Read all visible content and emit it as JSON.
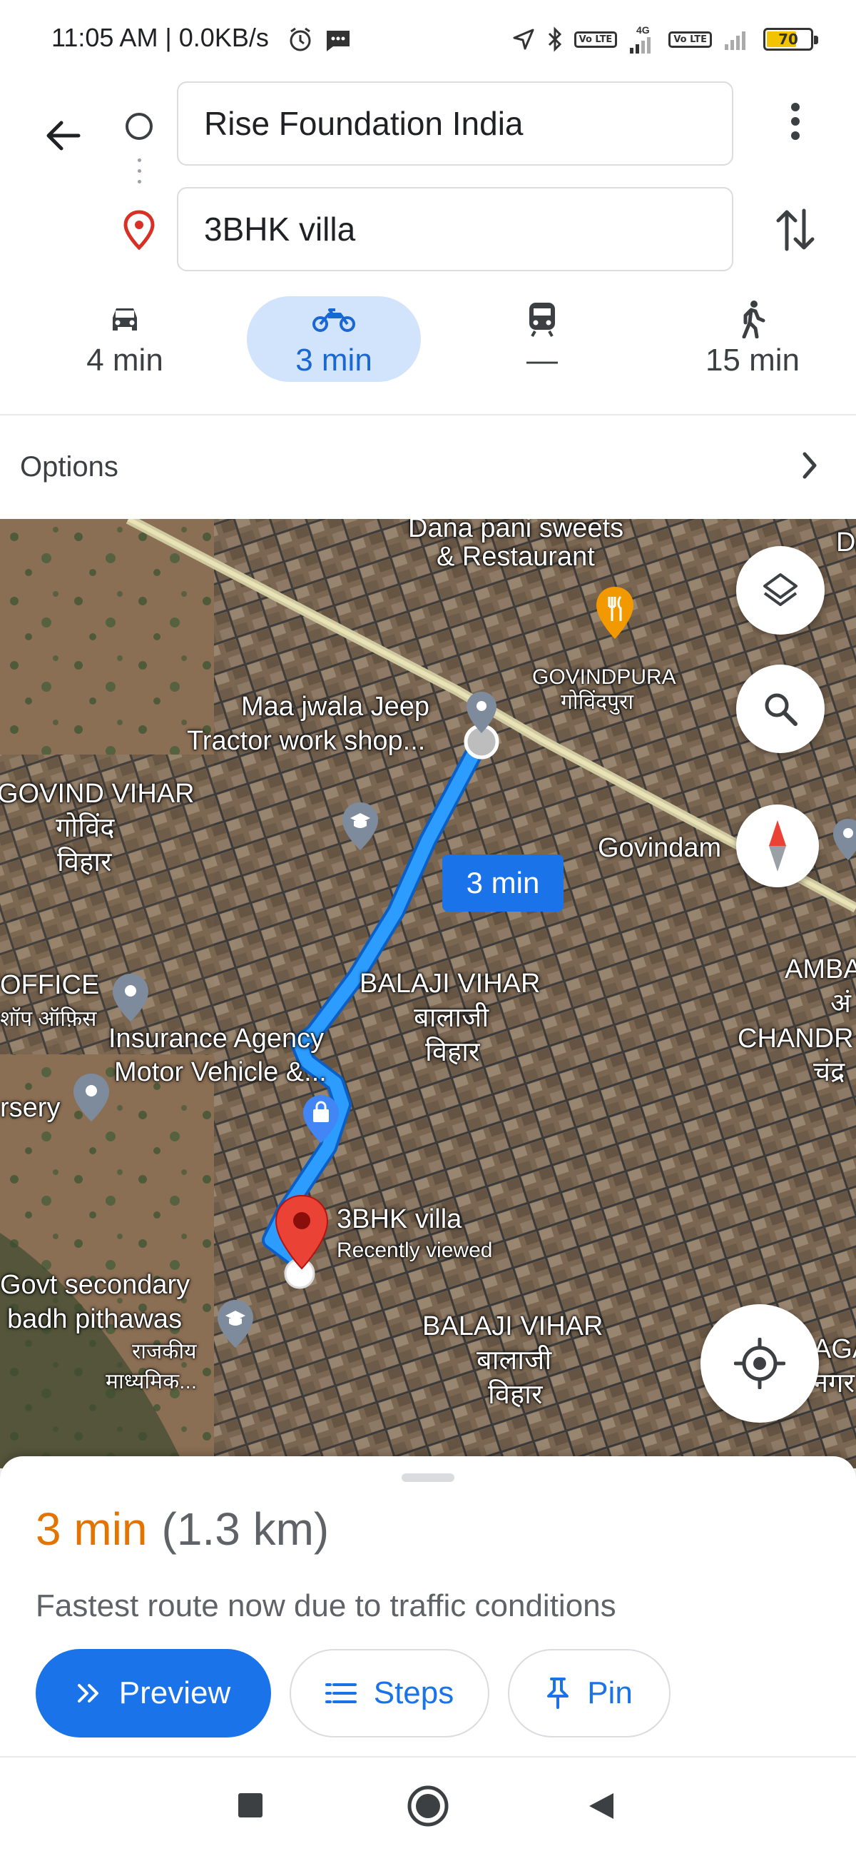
{
  "status_bar": {
    "time_speed": "11:05 AM | 0.0KB/s",
    "lte1": "Vo LTE",
    "network": "4G",
    "lte2": "Vo LTE",
    "battery": "70",
    "battery_level": 0.7,
    "icons": [
      "alarm-icon",
      "message-icon",
      "location-icon",
      "bluetooth-icon",
      "signal-icon",
      "signal-icon",
      "battery-icon"
    ]
  },
  "directions": {
    "origin": "Rise Foundation India",
    "destination": "3BHK villa"
  },
  "modes": [
    {
      "name": "drive",
      "icon": "car-icon",
      "time": "4 min"
    },
    {
      "name": "two-wheeler",
      "icon": "motorcycle-icon",
      "time": "3 min",
      "active": true
    },
    {
      "name": "transit",
      "icon": "train-icon",
      "time": "—"
    },
    {
      "name": "walk",
      "icon": "walking-icon",
      "time": "15 min"
    }
  ],
  "options_label": "Options",
  "map": {
    "labels": {
      "dana_pani_1": "Dana pani sweets",
      "dana_pani_2": "& Restaurant",
      "govindpura_en": "GOVINDPURA",
      "govindpura_hi": "गोविंदपुरा",
      "jeep_1": "Maa jwala Jeep",
      "jeep_2": "Tractor work shop...",
      "govind_vihar_en": "GOVIND VIHAR",
      "govind_vihar_hi1": "गोविंद",
      "govind_vihar_hi2": "विहार",
      "govindam": "Govindam",
      "office_en": "OFFICE",
      "office_hi": "शॉप ऑफ़िस",
      "balaji1_en": "BALAJI VIHAR",
      "balaji1_hi1": "बालाजी",
      "balaji1_hi2": "विहार",
      "amba": "AMBA",
      "amba_hi": "अं",
      "chandra": "CHANDR",
      "chandra_hi": "चंद्र",
      "insurance_1": "Insurance Agency",
      "insurance_2": "Motor Vehicle &...",
      "nursery": "rsery",
      "villa_title": "3BHK villa",
      "villa_sub": "Recently viewed",
      "govt_1": "Govt secondary",
      "govt_2": "badh pithawas",
      "govt_hi1": "राजकीय",
      "govt_hi2": "माध्यमिक...",
      "balaji2_en": "BALAJI VIHAR",
      "balaji2_hi1": "बालाजी",
      "balaji2_hi2": "विहार",
      "edge_d": "D",
      "edge_aga": "AGA",
      "edge_nagar": "नगर"
    },
    "route_badge": "3 min"
  },
  "summary": {
    "time": "3 min",
    "distance": "(1.3 km)",
    "note": "Fastest route now due to traffic conditions",
    "buttons": {
      "preview": "Preview",
      "steps": "Steps",
      "pin": "Pin"
    }
  },
  "colors": {
    "accent": "#1a73e8",
    "route": "#1e90ff",
    "time_orange": "#e37400",
    "active_mode_bg": "#d2e3fc"
  }
}
